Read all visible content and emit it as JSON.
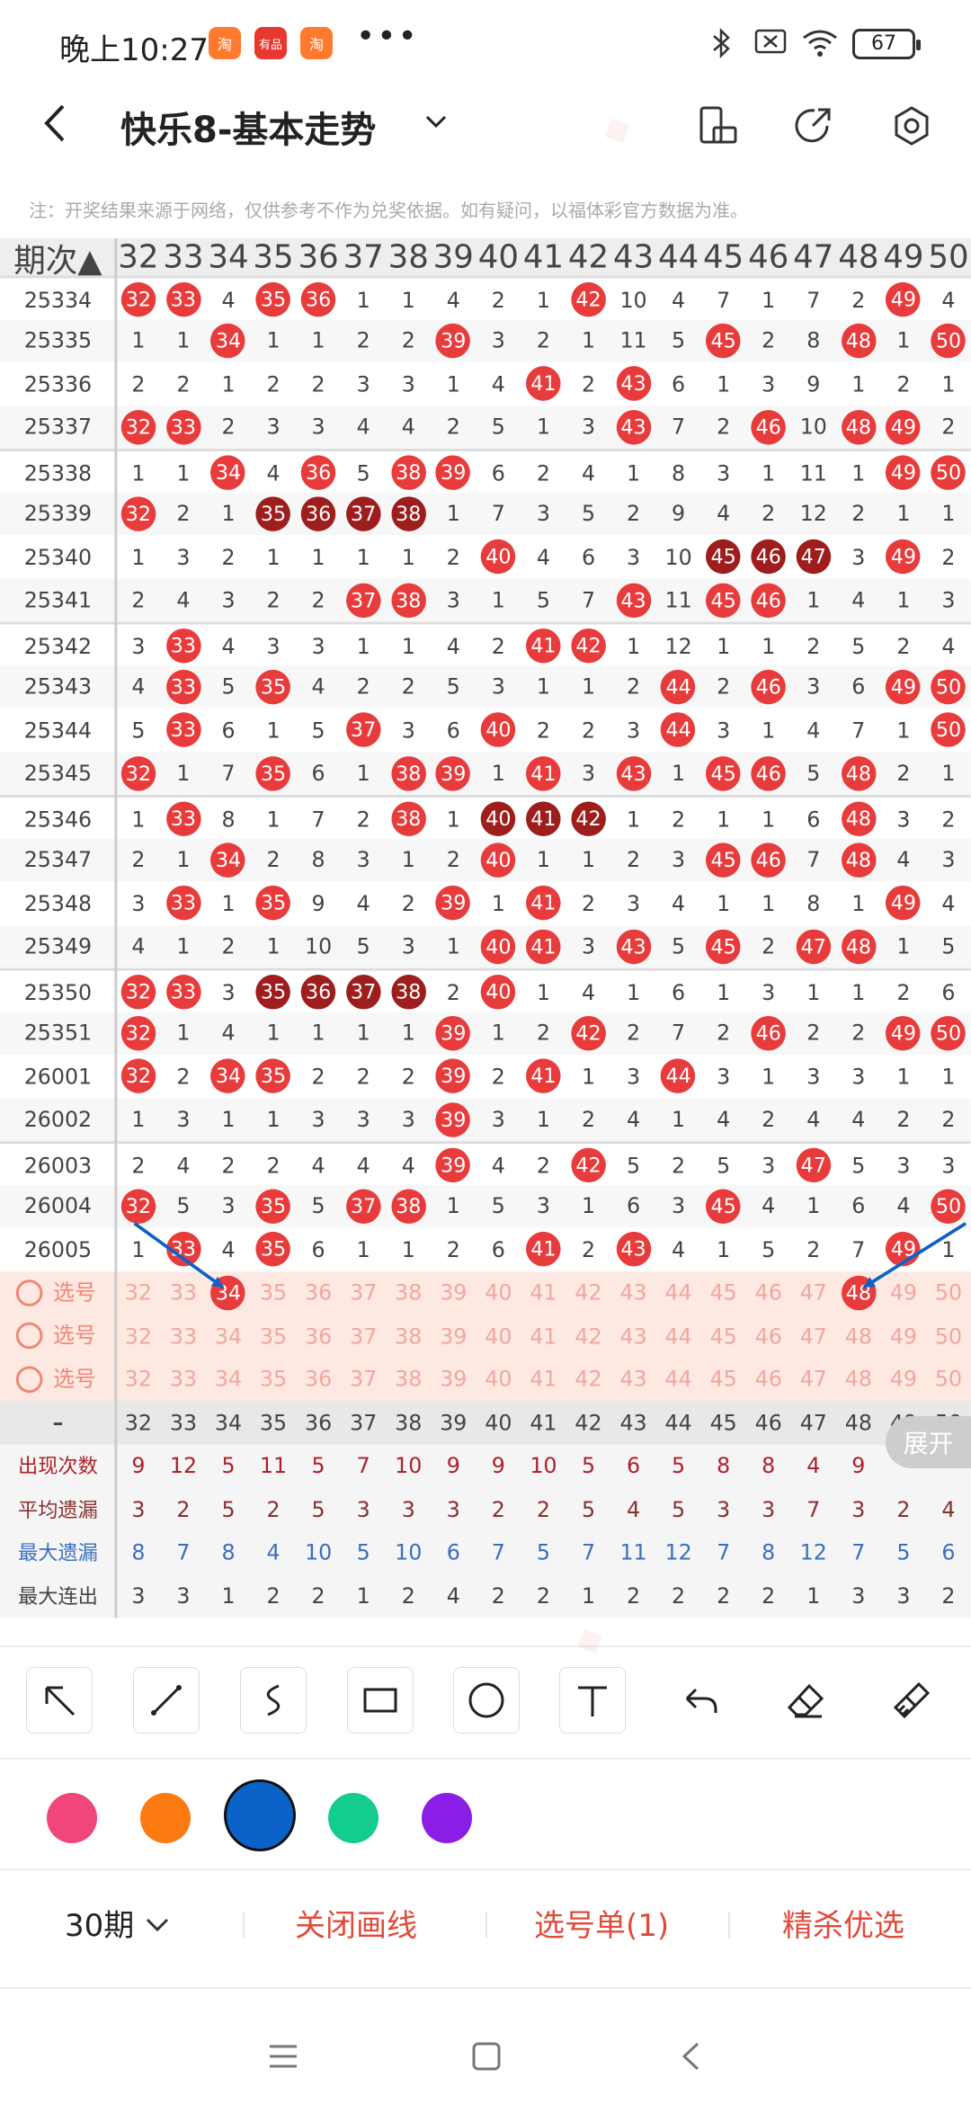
{
  "status": {
    "time": "晚上10:27",
    "app1": "淘",
    "app2": "有品",
    "app3": "淘",
    "dots": "•••",
    "battery": "67"
  },
  "header": {
    "title": "快乐8-基本走势"
  },
  "note": "注：开奖结果来源于网络，仅供参考不作为兑奖依据。如有疑问，以福体彩官方数据为准。",
  "table": {
    "period_header": "期次",
    "columns": [
      "32",
      "33",
      "34",
      "35",
      "36",
      "37",
      "38",
      "39",
      "40",
      "41",
      "42",
      "43",
      "44",
      "45",
      "46",
      "47",
      "48",
      "49",
      "50"
    ],
    "rows": [
      {
        "p": "25334",
        "v": [
          "32",
          "33",
          "4",
          "35",
          "36",
          "1",
          "1",
          "4",
          "2",
          "1",
          "42",
          "10",
          "4",
          "7",
          "1",
          "7",
          "2",
          "49",
          "4"
        ]
      },
      {
        "p": "25335",
        "v": [
          "1",
          "1",
          "34",
          "1",
          "1",
          "2",
          "2",
          "39",
          "3",
          "2",
          "1",
          "11",
          "5",
          "45",
          "2",
          "8",
          "48",
          "1",
          "50"
        ]
      },
      {
        "p": "25336",
        "v": [
          "2",
          "2",
          "1",
          "2",
          "2",
          "3",
          "3",
          "1",
          "4",
          "41",
          "2",
          "43",
          "6",
          "1",
          "3",
          "9",
          "1",
          "2",
          "1"
        ]
      },
      {
        "p": "25337",
        "v": [
          "32",
          "33",
          "2",
          "3",
          "3",
          "4",
          "4",
          "2",
          "5",
          "1",
          "3",
          "43",
          "7",
          "2",
          "46",
          "10",
          "48",
          "49",
          "2"
        ]
      },
      {
        "p": "25338",
        "v": [
          "1",
          "1",
          "34",
          "4",
          "36",
          "5",
          "38",
          "39",
          "6",
          "2",
          "4",
          "1",
          "8",
          "3",
          "1",
          "11",
          "1",
          "49",
          "50"
        ]
      },
      {
        "p": "25339",
        "v": [
          "32",
          "2",
          "1",
          "35",
          "36",
          "37",
          "38",
          "1",
          "7",
          "3",
          "5",
          "2",
          "9",
          "4",
          "2",
          "12",
          "2",
          "1",
          "1"
        ]
      },
      {
        "p": "25340",
        "v": [
          "1",
          "3",
          "2",
          "1",
          "1",
          "1",
          "1",
          "2",
          "40",
          "4",
          "6",
          "3",
          "10",
          "45",
          "46",
          "47",
          "3",
          "49",
          "2"
        ]
      },
      {
        "p": "25341",
        "v": [
          "2",
          "4",
          "3",
          "2",
          "2",
          "37",
          "38",
          "3",
          "1",
          "5",
          "7",
          "43",
          "11",
          "45",
          "46",
          "1",
          "4",
          "1",
          "3"
        ]
      },
      {
        "p": "25342",
        "v": [
          "3",
          "33",
          "4",
          "3",
          "3",
          "1",
          "1",
          "4",
          "2",
          "41",
          "42",
          "1",
          "12",
          "1",
          "1",
          "2",
          "5",
          "2",
          "4"
        ]
      },
      {
        "p": "25343",
        "v": [
          "4",
          "33",
          "5",
          "35",
          "4",
          "2",
          "2",
          "5",
          "3",
          "1",
          "1",
          "2",
          "44",
          "2",
          "46",
          "3",
          "6",
          "49",
          "50"
        ]
      },
      {
        "p": "25344",
        "v": [
          "5",
          "33",
          "6",
          "1",
          "5",
          "37",
          "3",
          "6",
          "40",
          "2",
          "2",
          "3",
          "44",
          "3",
          "1",
          "4",
          "7",
          "1",
          "50"
        ]
      },
      {
        "p": "25345",
        "v": [
          "32",
          "1",
          "7",
          "35",
          "6",
          "1",
          "38",
          "39",
          "1",
          "41",
          "3",
          "43",
          "1",
          "45",
          "46",
          "5",
          "48",
          "2",
          "1"
        ]
      },
      {
        "p": "25346",
        "v": [
          "1",
          "33",
          "8",
          "1",
          "7",
          "2",
          "38",
          "1",
          "40",
          "41",
          "42",
          "1",
          "2",
          "1",
          "1",
          "6",
          "48",
          "3",
          "2"
        ]
      },
      {
        "p": "25347",
        "v": [
          "2",
          "1",
          "34",
          "2",
          "8",
          "3",
          "1",
          "2",
          "40",
          "1",
          "1",
          "2",
          "3",
          "45",
          "46",
          "7",
          "48",
          "4",
          "3"
        ]
      },
      {
        "p": "25348",
        "v": [
          "3",
          "33",
          "1",
          "35",
          "9",
          "4",
          "2",
          "39",
          "1",
          "41",
          "2",
          "3",
          "4",
          "1",
          "1",
          "8",
          "1",
          "49",
          "4"
        ]
      },
      {
        "p": "25349",
        "v": [
          "4",
          "1",
          "2",
          "1",
          "10",
          "5",
          "3",
          "1",
          "40",
          "41",
          "3",
          "43",
          "5",
          "45",
          "2",
          "47",
          "48",
          "1",
          "5"
        ]
      },
      {
        "p": "25350",
        "v": [
          "32",
          "33",
          "3",
          "35",
          "36",
          "37",
          "38",
          "2",
          "40",
          "1",
          "4",
          "1",
          "6",
          "1",
          "3",
          "1",
          "1",
          "2",
          "6"
        ]
      },
      {
        "p": "25351",
        "v": [
          "32",
          "1",
          "4",
          "1",
          "1",
          "1",
          "1",
          "39",
          "1",
          "2",
          "42",
          "2",
          "7",
          "2",
          "46",
          "2",
          "2",
          "49",
          "50"
        ]
      },
      {
        "p": "26001",
        "v": [
          "32",
          "2",
          "34",
          "35",
          "2",
          "2",
          "2",
          "39",
          "2",
          "41",
          "1",
          "3",
          "44",
          "3",
          "1",
          "3",
          "3",
          "1",
          "1"
        ]
      },
      {
        "p": "26002",
        "v": [
          "1",
          "3",
          "1",
          "1",
          "3",
          "3",
          "3",
          "39",
          "3",
          "1",
          "2",
          "4",
          "1",
          "4",
          "2",
          "4",
          "4",
          "2",
          "2"
        ]
      },
      {
        "p": "26003",
        "v": [
          "2",
          "4",
          "2",
          "2",
          "4",
          "4",
          "4",
          "39",
          "4",
          "2",
          "42",
          "5",
          "2",
          "5",
          "3",
          "47",
          "5",
          "3",
          "3"
        ]
      },
      {
        "p": "26004",
        "v": [
          "32",
          "5",
          "3",
          "35",
          "5",
          "37",
          "38",
          "1",
          "5",
          "3",
          "1",
          "6",
          "3",
          "45",
          "4",
          "1",
          "6",
          "4",
          "50"
        ]
      },
      {
        "p": "26005",
        "v": [
          "1",
          "33",
          "4",
          "35",
          "6",
          "1",
          "1",
          "2",
          "6",
          "41",
          "2",
          "43",
          "4",
          "1",
          "5",
          "2",
          "7",
          "49",
          "1"
        ]
      }
    ],
    "select_rows": [
      {
        "label": "选号",
        "selected": [
          "34",
          "48"
        ]
      },
      {
        "label": "选号",
        "selected": []
      },
      {
        "label": "选号",
        "selected": []
      }
    ],
    "footer_header": "-",
    "stats": [
      {
        "label": "出现次数",
        "color": "#b0202a",
        "v": [
          "9",
          "12",
          "5",
          "11",
          "5",
          "7",
          "10",
          "9",
          "9",
          "10",
          "5",
          "6",
          "5",
          "8",
          "8",
          "4",
          "9",
          "",
          ""
        ]
      },
      {
        "label": "平均遗漏",
        "color": "#8a3030",
        "v": [
          "3",
          "2",
          "5",
          "2",
          "5",
          "3",
          "3",
          "3",
          "2",
          "2",
          "5",
          "4",
          "5",
          "3",
          "3",
          "7",
          "3",
          "2",
          "4"
        ]
      },
      {
        "label": "最大遗漏",
        "color": "#3a6fc0",
        "v": [
          "8",
          "7",
          "8",
          "4",
          "10",
          "5",
          "10",
          "6",
          "7",
          "5",
          "7",
          "11",
          "12",
          "7",
          "8",
          "12",
          "7",
          "5",
          "6"
        ]
      },
      {
        "label": "最大连出",
        "color": "#444",
        "v": [
          "3",
          "3",
          "1",
          "2",
          "2",
          "1",
          "2",
          "4",
          "2",
          "2",
          "1",
          "2",
          "2",
          "2",
          "2",
          "1",
          "3",
          "3",
          "2"
        ]
      }
    ],
    "dark_balls": [
      [
        5,
        "35"
      ],
      [
        5,
        "36"
      ],
      [
        5,
        "37"
      ],
      [
        5,
        "38"
      ],
      [
        6,
        "45"
      ],
      [
        6,
        "46"
      ],
      [
        6,
        "47"
      ],
      [
        12,
        "40"
      ],
      [
        12,
        "41"
      ],
      [
        12,
        "42"
      ],
      [
        16,
        "35"
      ],
      [
        16,
        "36"
      ],
      [
        16,
        "37"
      ],
      [
        16,
        "38"
      ]
    ]
  },
  "expand_label": "展开",
  "tools": [
    "arrow-tool",
    "line-tool",
    "curve-tool",
    "rect-tool",
    "circle-tool",
    "text-tool",
    "undo-tool",
    "eraser-tool",
    "clear-tool"
  ],
  "colors": [
    "#f0467a",
    "#fb7a12",
    "#0b63c8",
    "#14cc8c",
    "#8a1ee6"
  ],
  "bottom": {
    "periods": "30期",
    "close_draw": "关闭画线",
    "selection": "选号单(1)",
    "premium": "精杀优选"
  },
  "accent": "#e83c3c"
}
